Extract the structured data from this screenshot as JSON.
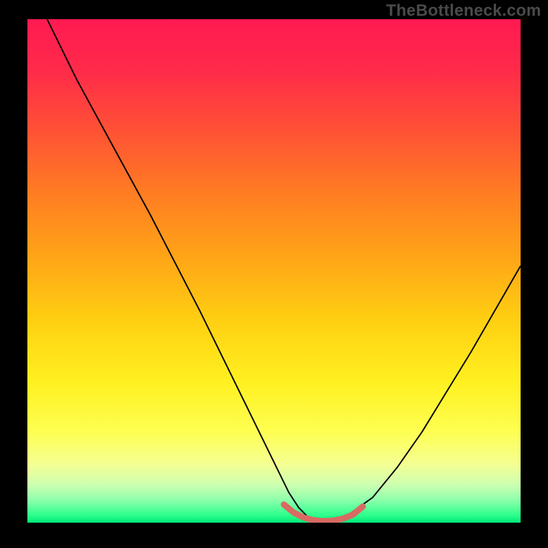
{
  "watermark": "TheBottleneck.com",
  "gradient_stops": [
    {
      "offset": 0.0,
      "color": "#ff1a52"
    },
    {
      "offset": 0.1,
      "color": "#ff2a4a"
    },
    {
      "offset": 0.22,
      "color": "#ff5135"
    },
    {
      "offset": 0.35,
      "color": "#ff7e22"
    },
    {
      "offset": 0.48,
      "color": "#ffa716"
    },
    {
      "offset": 0.6,
      "color": "#ffd012"
    },
    {
      "offset": 0.72,
      "color": "#fff020"
    },
    {
      "offset": 0.82,
      "color": "#feff52"
    },
    {
      "offset": 0.885,
      "color": "#f4ff94"
    },
    {
      "offset": 0.925,
      "color": "#ccffb0"
    },
    {
      "offset": 0.955,
      "color": "#8dffac"
    },
    {
      "offset": 0.985,
      "color": "#2eff8c"
    },
    {
      "offset": 1.0,
      "color": "#00e878"
    }
  ],
  "chart_data": {
    "type": "line",
    "title": "",
    "xlabel": "",
    "ylabel": "",
    "xlim": [
      0,
      100
    ],
    "ylim": [
      0,
      100
    ],
    "series": [
      {
        "name": "bottleneck-curve",
        "color": "#000000",
        "stroke_width": 2,
        "x": [
          4,
          10,
          15,
          20,
          25,
          30,
          35,
          40,
          45,
          50,
          53,
          55,
          57,
          60,
          63,
          65,
          70,
          75,
          80,
          85,
          90,
          95,
          100
        ],
        "values": [
          100,
          88,
          79,
          70,
          61,
          51.5,
          42,
          32,
          22,
          12,
          6,
          3,
          1,
          0.3,
          0.3,
          1.5,
          5,
          11,
          18,
          26,
          34,
          42.5,
          51
        ]
      },
      {
        "name": "optimal-band",
        "color": "#d86a62",
        "stroke_width": 9,
        "linecap": "round",
        "x": [
          52,
          54,
          56,
          58,
          60,
          62,
          64,
          66,
          68
        ],
        "values": [
          3.6,
          2.0,
          1.0,
          0.5,
          0.3,
          0.4,
          0.8,
          1.6,
          3.2
        ]
      }
    ]
  }
}
